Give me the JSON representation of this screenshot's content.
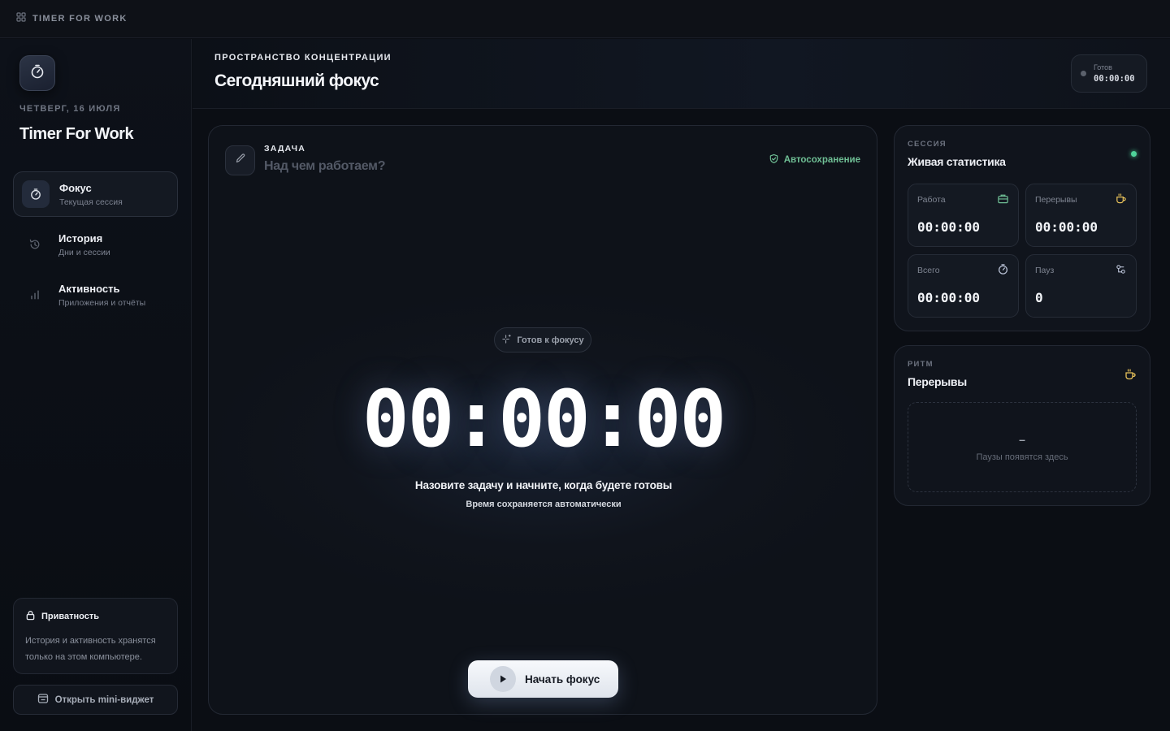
{
  "titlebar": {
    "app_name": "TIMER FOR WORK"
  },
  "sidebar": {
    "date": "ЧЕТВЕРГ, 16 ИЮЛЯ",
    "title": "Timer For Work",
    "items": [
      {
        "label": "Фокус",
        "sub": "Текущая сессия",
        "icon": "stopwatch-icon",
        "active": true
      },
      {
        "label": "История",
        "sub": "Дни и сессии",
        "icon": "history-icon",
        "active": false
      },
      {
        "label": "Активность",
        "sub": "Приложения и отчёты",
        "icon": "bar-chart-icon",
        "active": false
      }
    ],
    "privacy": {
      "title": "Приватность",
      "text": "История и активность хранятся только на этом компьютере."
    },
    "mini_widget_label": "Открыть mini-виджет"
  },
  "header": {
    "overline": "ПРОСТРАНСТВО КОНЦЕНТРАЦИИ",
    "title": "Сегодняшний фокус",
    "status": {
      "label": "Готов",
      "time": "00:00:00"
    }
  },
  "focus": {
    "task_label": "ЗАДАЧА",
    "task_placeholder": "Над чем работаем?",
    "task_value": "",
    "autosave": "Автосохранение",
    "ready_chip": "Готов к фокусу",
    "timer": "00:00:00",
    "hint_primary": "Назовите задачу и начните, когда будете готовы",
    "hint_secondary": "Время сохраняется автоматически",
    "start_label": "Начать фокус"
  },
  "session": {
    "overline": "СЕССИЯ",
    "title": "Живая статистика",
    "stats": [
      {
        "label": "Работа",
        "value": "00:00:00",
        "icon": "briefcase-icon"
      },
      {
        "label": "Перерывы",
        "value": "00:00:00",
        "icon": "coffee-icon"
      },
      {
        "label": "Всего",
        "value": "00:00:00",
        "icon": "stopwatch-icon"
      },
      {
        "label": "Пауз",
        "value": "0",
        "icon": "pause-flow-icon"
      }
    ]
  },
  "rhythm": {
    "overline": "РИТМ",
    "title": "Перерывы",
    "empty_dash": "–",
    "empty_text": "Паузы появятся здесь"
  },
  "colors": {
    "background": "#0b0e14",
    "accent_green": "#4fd39a",
    "autosave_green": "#6fbf95",
    "coffee_yellow": "#e8c25a"
  }
}
